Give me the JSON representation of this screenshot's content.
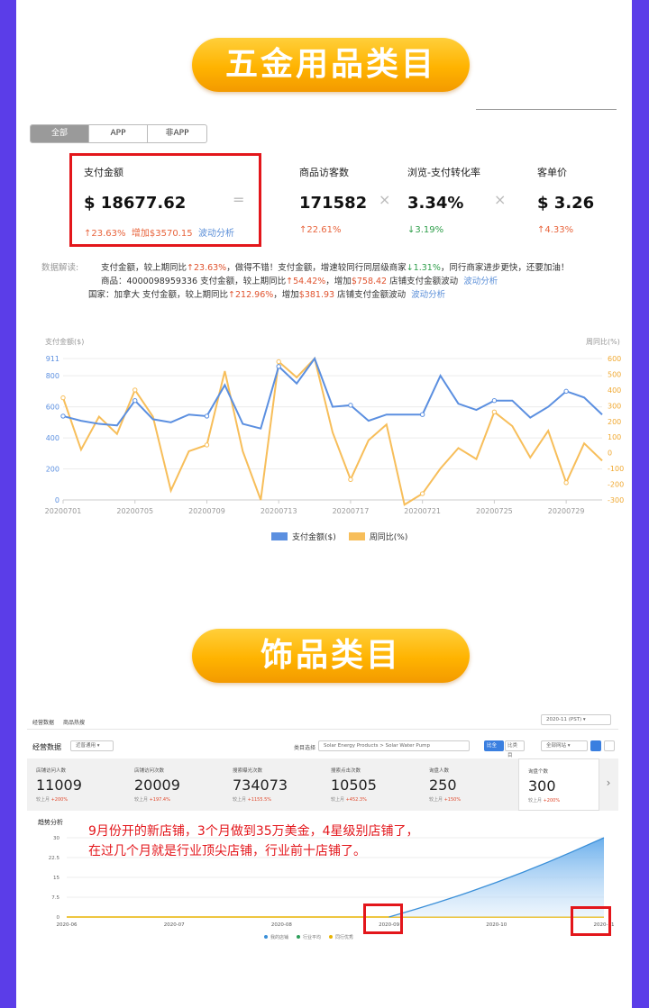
{
  "sections": {
    "hardware_title": "五金用品类目",
    "jewelry_title": "饰品类目"
  },
  "tabs": [
    "全部",
    "APP",
    "非APP"
  ],
  "kpis": [
    {
      "label": "支付金额",
      "value": "$ 18677.62",
      "change": "↑23.63%",
      "extra": "增加$3570.15",
      "link": "波动分析"
    },
    {
      "label": "商品访客数",
      "value": "171582",
      "change": "↑22.61%"
    },
    {
      "label": "浏览-支付转化率",
      "value": "3.34%",
      "change": "↓3.19%"
    },
    {
      "label": "客单价",
      "value": "$ 3.26",
      "change": "↑4.33%"
    }
  ],
  "operators": [
    "=",
    "×",
    "×"
  ],
  "analysis": {
    "label": "数据解读:",
    "l1a": "支付金额，较上期同比",
    "l1b": "↑23.63%",
    "l1c": "，做得不错！支付金额，增速较同行同层级商家",
    "l1d": "↓1.31%",
    "l1e": "，同行商家进步更快，还要加油！",
    "l2a": "商品：4000098959336   支付金额，较上期同比",
    "l2b": "↑54.42%",
    "l2c": "，增加",
    "l2d": "$758.42",
    "l2e": " 店铺支付金额波动",
    "l2f": "波动分析",
    "l3a": "国家：加拿大   支付金额，较上期同比",
    "l3b": "↑212.96%",
    "l3c": "，增加",
    "l3d": "$381.93",
    "l3e": " 店铺支付金额波动",
    "l3f": "波动分析"
  },
  "chart_data": [
    {
      "type": "line",
      "ylabel": "支付金额($)",
      "y2label": "周同比(%)",
      "ylim": [
        0,
        911
      ],
      "yticks": [
        0,
        200,
        400,
        600,
        800,
        911
      ],
      "y2lim": [
        -300,
        600
      ],
      "y2ticks": [
        -300,
        -200,
        -100,
        0,
        100,
        200,
        300,
        400,
        500,
        600
      ],
      "x": [
        "20200701",
        "20200702",
        "20200703",
        "20200704",
        "20200705",
        "20200706",
        "20200707",
        "20200708",
        "20200709",
        "20200710",
        "20200711",
        "20200712",
        "20200713",
        "20200714",
        "20200715",
        "20200716",
        "20200717",
        "20200718",
        "20200719",
        "20200720",
        "20200721",
        "20200722",
        "20200723",
        "20200724",
        "20200725",
        "20200726",
        "20200727",
        "20200728",
        "20200729",
        "20200730",
        "20200731"
      ],
      "xticks": [
        "20200701",
        "20200705",
        "20200709",
        "20200713",
        "20200717",
        "20200721",
        "20200725",
        "20200729"
      ],
      "series": [
        {
          "name": "支付金额($)",
          "color": "#5b8fe0",
          "axis": "left",
          "values": [
            540,
            510,
            490,
            480,
            640,
            520,
            500,
            550,
            540,
            740,
            490,
            460,
            860,
            750,
            911,
            600,
            610,
            510,
            550,
            550,
            550,
            800,
            620,
            580,
            640,
            640,
            530,
            600,
            700,
            660,
            550
          ]
        },
        {
          "name": "周同比(%)",
          "color": "#f7be5a",
          "axis": "right",
          "values": [
            350,
            20,
            230,
            120,
            400,
            230,
            -240,
            10,
            50,
            520,
            10,
            -300,
            580,
            480,
            600,
            130,
            -170,
            80,
            180,
            -330,
            -260,
            -100,
            30,
            -40,
            260,
            170,
            -30,
            140,
            -190,
            60,
            -50
          ]
        }
      ]
    },
    {
      "type": "area",
      "ylim": [
        0,
        30
      ],
      "yticks": [
        0,
        7.5,
        15,
        22.5,
        30
      ],
      "xticks": [
        "2020-06",
        "2020-07",
        "2020-08",
        "2020-09",
        "2020-10",
        "2020-11"
      ],
      "series": [
        {
          "name": "我的店铺",
          "color": "#3a8fd8",
          "x": [
            3,
            3.5,
            4,
            4.5,
            5
          ],
          "values": [
            0,
            6,
            13,
            21,
            30
          ]
        },
        {
          "name": "行业平均",
          "color": "#2e9e5a",
          "values": [
            0,
            0,
            0,
            0,
            0,
            0
          ]
        },
        {
          "name": "同行优秀",
          "color": "#e8b400",
          "values": [
            0,
            0,
            0,
            0,
            0,
            0
          ]
        }
      ]
    }
  ],
  "dashboard": {
    "nav1": "经营数据",
    "nav2": "商品热搜",
    "date": "2020-11 (PST)",
    "title": "经营数据",
    "range": "近普通用",
    "cat_label": "类目选择",
    "cat_value": "Solar Energy Products > Solar Water Pump",
    "btn1": "比全店",
    "btn2": "比类目",
    "site": "全部网站",
    "trend": "趋势分析",
    "stats": [
      {
        "label": "店铺访问人数",
        "value": "11009",
        "pre": "较上月",
        "chg": "+200%"
      },
      {
        "label": "店铺访问次数",
        "value": "20009",
        "pre": "较上月",
        "chg": "+197.4%"
      },
      {
        "label": "搜索曝光次数",
        "value": "734073",
        "pre": "较上月",
        "chg": "+1155.5%"
      },
      {
        "label": "搜索点击次数",
        "value": "10505",
        "pre": "较上月",
        "chg": "+452.3%"
      },
      {
        "label": "询盘人数",
        "value": "250",
        "pre": "较上月",
        "chg": "+150%"
      },
      {
        "label": "询盘个数",
        "value": "300",
        "pre": "较上月",
        "chg": "+200%"
      }
    ],
    "legend": [
      "我的店铺",
      "行业平均",
      "同行优秀"
    ]
  },
  "overlay_text": [
    "9月份开的新店铺，3个月做到35万美金，4星级别店铺了，",
    "在过几个月就是行业顶尖店铺，行业前十店铺了。"
  ]
}
